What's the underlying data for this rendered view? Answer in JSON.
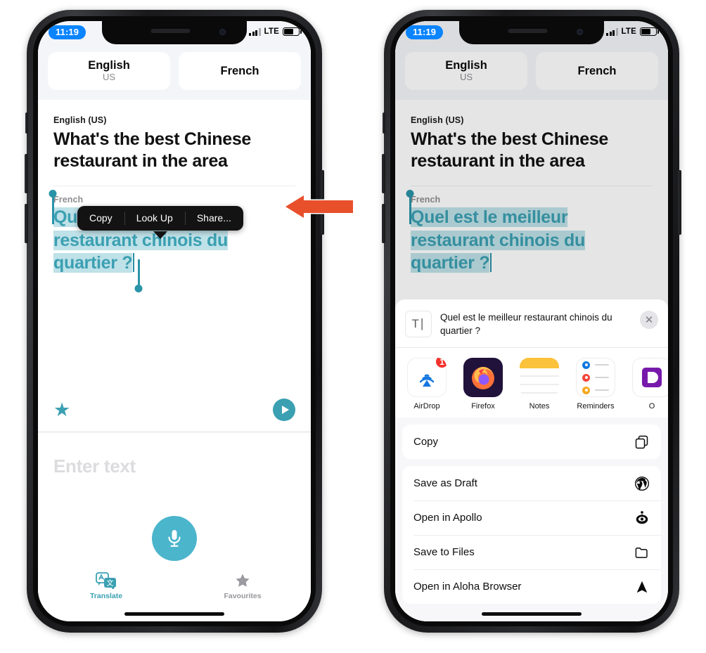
{
  "status_bar": {
    "time": "11:19",
    "network": "LTE",
    "signal_icon": "signal-bars-icon",
    "battery_icon": "battery-icon"
  },
  "language_bar": {
    "source": {
      "name": "English",
      "region": "US"
    },
    "target": {
      "name": "French",
      "region": ""
    }
  },
  "translation": {
    "source_label": "English (US)",
    "source_text": "What's the best Chinese restaurant in the area",
    "target_label": "French",
    "target_text": "Quel est le meilleur restaurant chinois du quartier ?"
  },
  "context_menu": {
    "items": [
      "Copy",
      "Look Up",
      "Share..."
    ]
  },
  "annotation": {
    "arrow_color": "#e8502b",
    "points_to": "Share..."
  },
  "input_area": {
    "placeholder": "Enter text",
    "mic_icon": "microphone-icon",
    "mic_color": "#4bb5cc"
  },
  "translate_actions": {
    "favourite_icon": "star-icon",
    "play_icon": "play-icon",
    "accent_color": "#3ba0b2"
  },
  "tab_bar": {
    "tabs": [
      {
        "label": "Translate",
        "icon": "translate-icon",
        "active": true
      },
      {
        "label": "Favourites",
        "icon": "star-icon",
        "active": false
      }
    ]
  },
  "share_sheet": {
    "preview": {
      "icon": "text-document-icon",
      "title": "Quel est le meilleur restaurant chinois du quartier ?"
    },
    "close_label": "✕",
    "apps": [
      {
        "name": "AirDrop",
        "icon": "airdrop-icon",
        "badge": "1"
      },
      {
        "name": "Firefox",
        "icon": "firefox-icon",
        "badge": ""
      },
      {
        "name": "Notes",
        "icon": "notes-icon",
        "badge": ""
      },
      {
        "name": "Reminders",
        "icon": "reminders-icon",
        "badge": ""
      },
      {
        "name": "O",
        "icon": "onedrive-icon",
        "badge": ""
      }
    ],
    "actions_primary": [
      {
        "label": "Copy",
        "icon": "copy-icon"
      }
    ],
    "actions_secondary": [
      {
        "label": "Save as Draft",
        "icon": "wordpress-icon"
      },
      {
        "label": "Open in Apollo",
        "icon": "apollo-icon"
      },
      {
        "label": "Save to Files",
        "icon": "folder-icon"
      },
      {
        "label": "Open in Aloha Browser",
        "icon": "aloha-icon"
      }
    ]
  }
}
